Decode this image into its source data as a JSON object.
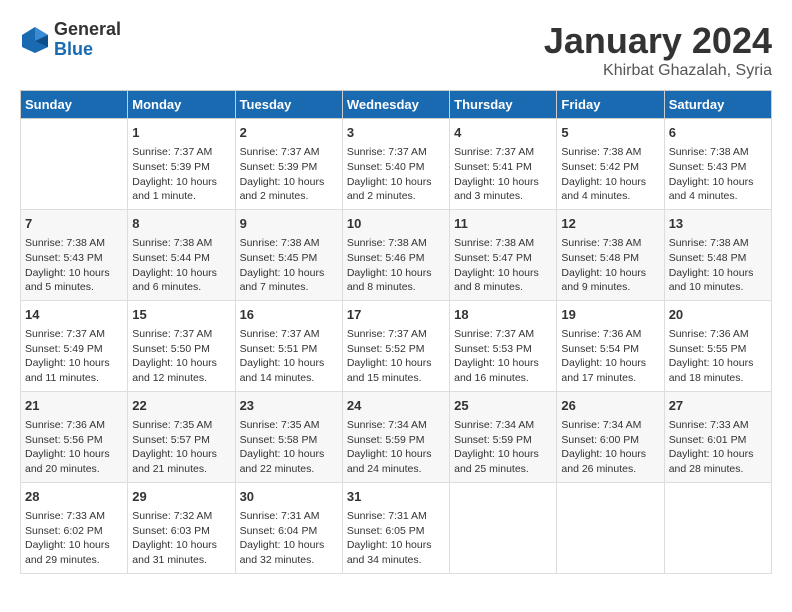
{
  "header": {
    "logo_general": "General",
    "logo_blue": "Blue",
    "title": "January 2024",
    "location": "Khirbat Ghazalah, Syria"
  },
  "days_of_week": [
    "Sunday",
    "Monday",
    "Tuesday",
    "Wednesday",
    "Thursday",
    "Friday",
    "Saturday"
  ],
  "weeks": [
    [
      {
        "day": "",
        "info": ""
      },
      {
        "day": "1",
        "info": "Sunrise: 7:37 AM\nSunset: 5:39 PM\nDaylight: 10 hours\nand 1 minute."
      },
      {
        "day": "2",
        "info": "Sunrise: 7:37 AM\nSunset: 5:39 PM\nDaylight: 10 hours\nand 2 minutes."
      },
      {
        "day": "3",
        "info": "Sunrise: 7:37 AM\nSunset: 5:40 PM\nDaylight: 10 hours\nand 2 minutes."
      },
      {
        "day": "4",
        "info": "Sunrise: 7:37 AM\nSunset: 5:41 PM\nDaylight: 10 hours\nand 3 minutes."
      },
      {
        "day": "5",
        "info": "Sunrise: 7:38 AM\nSunset: 5:42 PM\nDaylight: 10 hours\nand 4 minutes."
      },
      {
        "day": "6",
        "info": "Sunrise: 7:38 AM\nSunset: 5:43 PM\nDaylight: 10 hours\nand 4 minutes."
      }
    ],
    [
      {
        "day": "7",
        "info": "Sunrise: 7:38 AM\nSunset: 5:43 PM\nDaylight: 10 hours\nand 5 minutes."
      },
      {
        "day": "8",
        "info": "Sunrise: 7:38 AM\nSunset: 5:44 PM\nDaylight: 10 hours\nand 6 minutes."
      },
      {
        "day": "9",
        "info": "Sunrise: 7:38 AM\nSunset: 5:45 PM\nDaylight: 10 hours\nand 7 minutes."
      },
      {
        "day": "10",
        "info": "Sunrise: 7:38 AM\nSunset: 5:46 PM\nDaylight: 10 hours\nand 8 minutes."
      },
      {
        "day": "11",
        "info": "Sunrise: 7:38 AM\nSunset: 5:47 PM\nDaylight: 10 hours\nand 8 minutes."
      },
      {
        "day": "12",
        "info": "Sunrise: 7:38 AM\nSunset: 5:48 PM\nDaylight: 10 hours\nand 9 minutes."
      },
      {
        "day": "13",
        "info": "Sunrise: 7:38 AM\nSunset: 5:48 PM\nDaylight: 10 hours\nand 10 minutes."
      }
    ],
    [
      {
        "day": "14",
        "info": "Sunrise: 7:37 AM\nSunset: 5:49 PM\nDaylight: 10 hours\nand 11 minutes."
      },
      {
        "day": "15",
        "info": "Sunrise: 7:37 AM\nSunset: 5:50 PM\nDaylight: 10 hours\nand 12 minutes."
      },
      {
        "day": "16",
        "info": "Sunrise: 7:37 AM\nSunset: 5:51 PM\nDaylight: 10 hours\nand 14 minutes."
      },
      {
        "day": "17",
        "info": "Sunrise: 7:37 AM\nSunset: 5:52 PM\nDaylight: 10 hours\nand 15 minutes."
      },
      {
        "day": "18",
        "info": "Sunrise: 7:37 AM\nSunset: 5:53 PM\nDaylight: 10 hours\nand 16 minutes."
      },
      {
        "day": "19",
        "info": "Sunrise: 7:36 AM\nSunset: 5:54 PM\nDaylight: 10 hours\nand 17 minutes."
      },
      {
        "day": "20",
        "info": "Sunrise: 7:36 AM\nSunset: 5:55 PM\nDaylight: 10 hours\nand 18 minutes."
      }
    ],
    [
      {
        "day": "21",
        "info": "Sunrise: 7:36 AM\nSunset: 5:56 PM\nDaylight: 10 hours\nand 20 minutes."
      },
      {
        "day": "22",
        "info": "Sunrise: 7:35 AM\nSunset: 5:57 PM\nDaylight: 10 hours\nand 21 minutes."
      },
      {
        "day": "23",
        "info": "Sunrise: 7:35 AM\nSunset: 5:58 PM\nDaylight: 10 hours\nand 22 minutes."
      },
      {
        "day": "24",
        "info": "Sunrise: 7:34 AM\nSunset: 5:59 PM\nDaylight: 10 hours\nand 24 minutes."
      },
      {
        "day": "25",
        "info": "Sunrise: 7:34 AM\nSunset: 5:59 PM\nDaylight: 10 hours\nand 25 minutes."
      },
      {
        "day": "26",
        "info": "Sunrise: 7:34 AM\nSunset: 6:00 PM\nDaylight: 10 hours\nand 26 minutes."
      },
      {
        "day": "27",
        "info": "Sunrise: 7:33 AM\nSunset: 6:01 PM\nDaylight: 10 hours\nand 28 minutes."
      }
    ],
    [
      {
        "day": "28",
        "info": "Sunrise: 7:33 AM\nSunset: 6:02 PM\nDaylight: 10 hours\nand 29 minutes."
      },
      {
        "day": "29",
        "info": "Sunrise: 7:32 AM\nSunset: 6:03 PM\nDaylight: 10 hours\nand 31 minutes."
      },
      {
        "day": "30",
        "info": "Sunrise: 7:31 AM\nSunset: 6:04 PM\nDaylight: 10 hours\nand 32 minutes."
      },
      {
        "day": "31",
        "info": "Sunrise: 7:31 AM\nSunset: 6:05 PM\nDaylight: 10 hours\nand 34 minutes."
      },
      {
        "day": "",
        "info": ""
      },
      {
        "day": "",
        "info": ""
      },
      {
        "day": "",
        "info": ""
      }
    ]
  ]
}
